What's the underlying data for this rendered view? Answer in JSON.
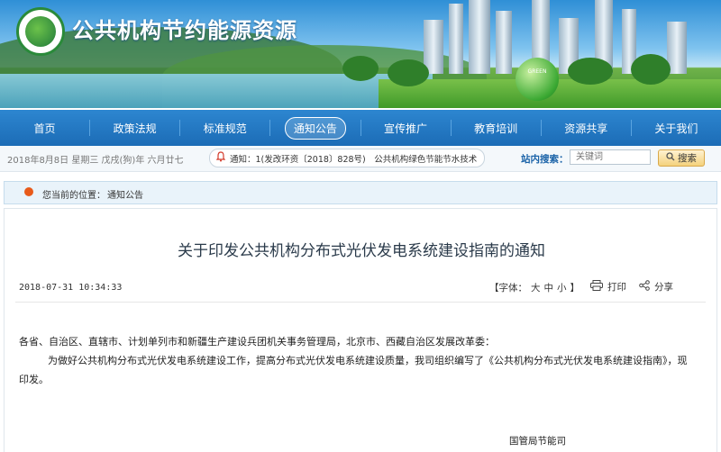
{
  "header": {
    "site_title": "公共机构节约能源资源",
    "globe_text": "GREEN"
  },
  "nav": {
    "items": [
      {
        "label": "首页"
      },
      {
        "label": "政策法规"
      },
      {
        "label": "标准规范"
      },
      {
        "label": "通知公告",
        "active": true
      },
      {
        "label": "宣传推广"
      },
      {
        "label": "教育培训"
      },
      {
        "label": "资源共享"
      },
      {
        "label": "关于我们"
      }
    ]
  },
  "infobar": {
    "date_text": "2018年8月8日 星期三 戊戌(狗)年 六月廿七",
    "notice_text": "通知：1(发改环资〔2018〕828号)　公共机构绿色节能节水技术",
    "search_label": "站内搜索：",
    "search_placeholder": "关键词",
    "search_button": "搜索"
  },
  "breadcrumb": {
    "label": "您当前的位置：",
    "current": "通知公告"
  },
  "article": {
    "title": "关于印发公共机构分布式光伏发电系统建设指南的通知",
    "date": "2018-07-31 10:34:33",
    "font_label": "【字体：",
    "font_large": "大",
    "font_medium": "中",
    "font_small": "小",
    "font_close": "】",
    "print_label": "打印",
    "share_label": "分享",
    "recipients": "各省、自治区、直辖市、计划单列市和新疆生产建设兵团机关事务管理局，北京市、西藏自治区发展改革委：",
    "body_line1": "为做好公共机构分布式光伏发电系统建设工作，提高分布式光伏发电系统建设质量，我司组织编写了《公共机构分布式光伏发电系统建设指南》，现",
    "body_line2": "印发。",
    "signature": "国管局节能司"
  },
  "colors": {
    "nav_bg": "#1c6cb6",
    "search_label": "#1b63a8",
    "bell": "#d43b2b",
    "pin": "#e85a1a"
  }
}
